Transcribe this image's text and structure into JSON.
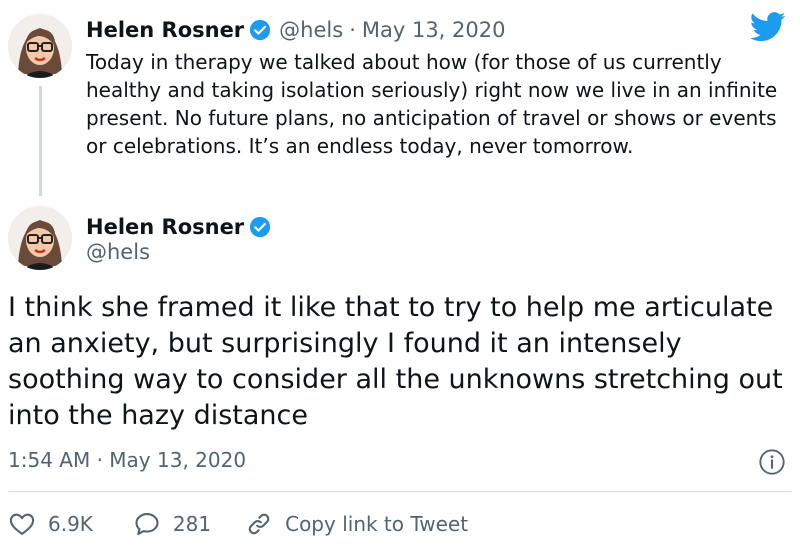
{
  "colors": {
    "verified": "#1d9bf0",
    "twitter_brand": "#1d9bf0",
    "text_primary": "#0f1419",
    "text_secondary": "#536471",
    "divider": "#cfd9de"
  },
  "icons": {
    "verified": "verified-badge-icon",
    "logo": "twitter-bird-icon",
    "info": "info-icon",
    "like": "heart-icon",
    "reply": "reply-bubble-icon",
    "copy_link": "link-icon"
  },
  "parent_tweet": {
    "author_name": "Helen Rosner",
    "handle": "@hels",
    "separator": "·",
    "date": "May 13, 2020",
    "text": "Today in therapy we talked about how (for those of us currently healthy and taking isolation seriously) right now we live in an infinite present. No future plans, no anticipation of travel or shows or events or celebrations. It’s an endless today, never tomorrow."
  },
  "main_tweet": {
    "author_name": "Helen Rosner",
    "handle": "@hels",
    "text": "I think she framed it like that to try to help me articulate an anxiety, but surprisingly I found it an intensely soothing way to consider all the unknowns stretching out into the hazy distance",
    "time": "1:54 AM",
    "separator": "·",
    "date": "May 13, 2020"
  },
  "actions": {
    "likes": "6.9K",
    "replies": "281",
    "copy_link_label": "Copy link to Tweet"
  }
}
